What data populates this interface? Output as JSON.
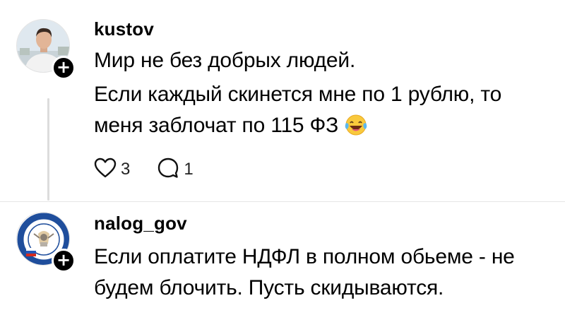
{
  "posts": [
    {
      "username": "kustov",
      "lines": [
        "Мир не без добрых людей.",
        "Если каждый скинется мне по 1 рублю, то",
        "меня заблочат по 115 ФЗ"
      ],
      "emoji": "face-with-tears-of-joy",
      "likes": "3",
      "replies": "1",
      "avatar_icon": "person-photo",
      "plus_label": "+"
    },
    {
      "username": "nalog_gov",
      "lines": [
        "Если оплатите НДФЛ в полном обьеме - не",
        "будем блочить. Пусть скидываются."
      ],
      "avatar_icon": "tax-service-emblem",
      "plus_label": "+"
    }
  ],
  "colors": {
    "text": "#000000",
    "thread_line": "#dcdcdc",
    "divider": "#e6e6e6",
    "badge": "#000000"
  }
}
